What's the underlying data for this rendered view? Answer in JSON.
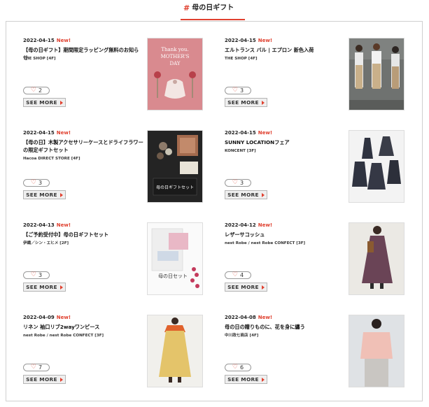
{
  "header": {
    "title": "母の日ギフト"
  },
  "items": [
    {
      "date": "2022-04-15",
      "new_label": "New!",
      "title": "【母の日ギフト】期間限定ラッピング無料のお知らせ",
      "shop": "THE SHOP [4F]",
      "likes": "2",
      "more_label": "SEE MORE",
      "image": {
        "label": "Thank you. MOTHER'S DAY",
        "bg": "#d98a8f",
        "accent": "#b8404a"
      }
    },
    {
      "date": "2022-04-15",
      "new_label": "New!",
      "title": "エルトランス バル | エプロン 新色入荷",
      "shop": "THE SHOP [4F]",
      "likes": "3",
      "more_label": "SEE MORE",
      "image": {
        "bg": "#6f7270",
        "accent": "#c9b08a"
      }
    },
    {
      "date": "2022-04-15",
      "new_label": "New!",
      "title": "【母の日】木製アクセサリーケースとドライフラワーの限定ギフトセット",
      "shop": "Hacoa DIRECT STORE [4F]",
      "likes": "3",
      "more_label": "SEE MORE",
      "image": {
        "label": "母の日ギフトセット",
        "bg": "#242424",
        "accent": "#a46b4e"
      }
    },
    {
      "date": "2022-04-15",
      "new_label": "New!",
      "title": "SUNNY LOCATIONフェア",
      "shop": "KONCENT [3F]",
      "likes": "3",
      "more_label": "SEE MORE",
      "image": {
        "bg": "#f3f3f3",
        "accent": "#2f3340"
      }
    },
    {
      "date": "2022-04-13",
      "new_label": "New!",
      "title": "【ご予約受付中】母の日ギフトセット",
      "shop": "伊織／シン・エヒメ [2F]",
      "likes": "3",
      "more_label": "SEE MORE",
      "image": {
        "label": "母の日セット",
        "bg": "#fafafa",
        "accent": "#c33a5c"
      }
    },
    {
      "date": "2022-04-12",
      "new_label": "New!",
      "title": "レザーサコッシュ",
      "shop": "nest Robe / nest Robe CONFECT [3F]",
      "likes": "4",
      "more_label": "SEE MORE",
      "image": {
        "bg": "#ebe9e4",
        "accent": "#6a4456"
      }
    },
    {
      "date": "2022-04-09",
      "new_label": "New!",
      "title": "リネン 袖口リブ2wayワンピース",
      "shop": "nest Robe / nest Robe CONFECT [3F]",
      "likes": "7",
      "more_label": "SEE MORE",
      "image": {
        "bg": "#f1f0ec",
        "accent": "#e4c46a"
      }
    },
    {
      "date": "2022-04-08",
      "new_label": "New!",
      "title": "母の日の贈りものに、花を身に纏う",
      "shop": "中川政七商店 [4F]",
      "likes": "6",
      "more_label": "SEE MORE",
      "image": {
        "bg": "#dfe2e5",
        "accent": "#f0c0b6"
      }
    }
  ]
}
